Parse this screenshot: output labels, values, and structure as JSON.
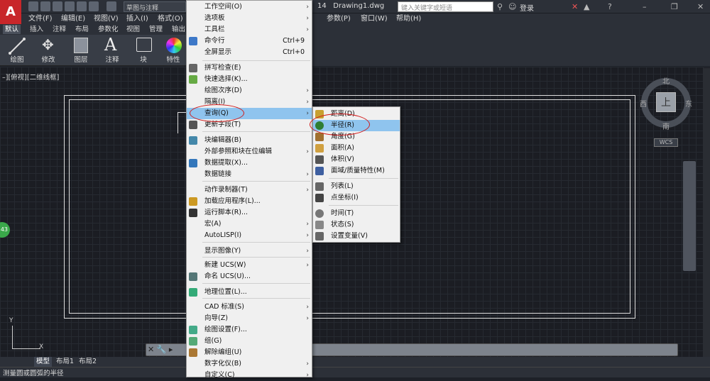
{
  "titlebar": {
    "workspace": "草图与注释",
    "doc_title": "Drawing1.dwg",
    "doc_prefix": "14",
    "search_placeholder": "键入关键字或短语",
    "login": "登录"
  },
  "menubar": [
    "文件(F)",
    "编辑(E)",
    "视图(V)",
    "插入(I)",
    "格式(O)",
    "参数(P)",
    "窗口(W)",
    "帮助(H)"
  ],
  "ribbon_tabs": [
    "默认",
    "插入",
    "注释",
    "布局",
    "参数化",
    "视图",
    "管理",
    "输出"
  ],
  "ribbon_buttons": [
    "绘图",
    "修改",
    "图层",
    "注释",
    "块",
    "特性"
  ],
  "viewport": {
    "label": "–][俯视][二维线框]"
  },
  "viewcube": {
    "face": "上",
    "north": "北",
    "south": "南",
    "east": "东",
    "west": "西",
    "wcs": "WCS"
  },
  "circle_badge": "43",
  "layout_tabs": [
    "模型",
    "布局1",
    "布局2"
  ],
  "status_text": "测量圆或圆弧的半径",
  "tools_menu": {
    "items": [
      {
        "label": "工作空间(O)",
        "shortcut": "",
        "submenu": true,
        "icon": ""
      },
      {
        "label": "选项板",
        "shortcut": "",
        "submenu": true,
        "icon": ""
      },
      {
        "label": "工具栏",
        "shortcut": "",
        "submenu": true,
        "icon": ""
      },
      {
        "label": "命令行",
        "shortcut": "Ctrl+9",
        "submenu": false,
        "icon": "command-line-icon"
      },
      {
        "label": "全屏显示",
        "shortcut": "Ctrl+0",
        "submenu": false,
        "icon": ""
      },
      {
        "label": "拼写检查(E)",
        "shortcut": "",
        "submenu": false,
        "icon": "spell-check-icon"
      },
      {
        "label": "快速选择(K)...",
        "shortcut": "",
        "submenu": false,
        "icon": "quick-select-icon"
      },
      {
        "label": "绘图次序(D)",
        "shortcut": "",
        "submenu": true,
        "icon": ""
      },
      {
        "label": "隔离(I)",
        "shortcut": "",
        "submenu": true,
        "icon": ""
      },
      {
        "label": "查询(Q)",
        "shortcut": "",
        "submenu": true,
        "icon": ""
      },
      {
        "label": "更新字段(T)",
        "shortcut": "",
        "submenu": false,
        "icon": "update-field-icon"
      },
      {
        "label": "块编辑器(B)",
        "shortcut": "",
        "submenu": false,
        "icon": "block-editor-icon"
      },
      {
        "label": "外部参照和块在位编辑",
        "shortcut": "",
        "submenu": true,
        "icon": ""
      },
      {
        "label": "数据提取(X)...",
        "shortcut": "",
        "submenu": false,
        "icon": "data-extraction-icon"
      },
      {
        "label": "数据链接",
        "shortcut": "",
        "submenu": true,
        "icon": ""
      },
      {
        "label": "动作录制器(T)",
        "shortcut": "",
        "submenu": true,
        "icon": ""
      },
      {
        "label": "加载应用程序(L)...",
        "shortcut": "",
        "submenu": false,
        "icon": "load-app-icon"
      },
      {
        "label": "运行脚本(R)...",
        "shortcut": "",
        "submenu": false,
        "icon": "run-script-icon"
      },
      {
        "label": "宏(A)",
        "shortcut": "",
        "submenu": true,
        "icon": ""
      },
      {
        "label": "AutoLISP(I)",
        "shortcut": "",
        "submenu": true,
        "icon": ""
      },
      {
        "label": "显示图像(Y)",
        "shortcut": "",
        "submenu": true,
        "icon": ""
      },
      {
        "label": "新建 UCS(W)",
        "shortcut": "",
        "submenu": true,
        "icon": ""
      },
      {
        "label": "命名 UCS(U)...",
        "shortcut": "",
        "submenu": false,
        "icon": "named-ucs-icon"
      },
      {
        "label": "地理位置(L)...",
        "shortcut": "",
        "submenu": false,
        "icon": "geolocation-icon"
      },
      {
        "label": "CAD 标准(S)",
        "shortcut": "",
        "submenu": true,
        "icon": ""
      },
      {
        "label": "向导(Z)",
        "shortcut": "",
        "submenu": true,
        "icon": ""
      },
      {
        "label": "绘图设置(F)...",
        "shortcut": "",
        "submenu": false,
        "icon": "drafting-settings-icon"
      },
      {
        "label": "组(G)",
        "shortcut": "",
        "submenu": false,
        "icon": "group-icon"
      },
      {
        "label": "解除编组(U)",
        "shortcut": "",
        "submenu": false,
        "icon": "ungroup-icon"
      },
      {
        "label": "数字化仪(B)",
        "shortcut": "",
        "submenu": true,
        "icon": ""
      },
      {
        "label": "自定义(C)",
        "shortcut": "",
        "submenu": true,
        "icon": ""
      }
    ]
  },
  "inquiry_menu": {
    "items": [
      {
        "label": "距离(D)",
        "icon": "distance-icon"
      },
      {
        "label": "半径(R)",
        "icon": "radius-icon"
      },
      {
        "label": "角度(G)",
        "icon": "angle-icon"
      },
      {
        "label": "面积(A)",
        "icon": "area-icon"
      },
      {
        "label": "体积(V)",
        "icon": "volume-icon"
      },
      {
        "label": "面域/质量特性(M)",
        "icon": "mass-properties-icon"
      },
      {
        "label": "列表(L)",
        "icon": "list-icon"
      },
      {
        "label": "点坐标(I)",
        "icon": "point-coord-icon"
      },
      {
        "label": "时间(T)",
        "icon": "time-icon"
      },
      {
        "label": "状态(S)",
        "icon": "status-icon"
      },
      {
        "label": "设置变量(V)",
        "icon": "set-variable-icon"
      }
    ]
  }
}
